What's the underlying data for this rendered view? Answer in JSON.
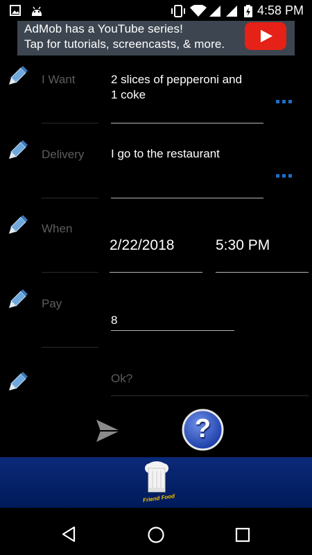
{
  "status_bar": {
    "time": "4:58 PM",
    "icons": [
      "image-icon",
      "android-icon",
      "vibrate-icon",
      "wifi-icon",
      "signal-icon",
      "signal-icon",
      "battery-charging-icon"
    ]
  },
  "ad": {
    "line1": "AdMob has a YouTube series!",
    "line2": "Tap for tutorials, screencasts, & more.",
    "icon": "youtube-play-icon",
    "brand_color": "#e62117"
  },
  "form": {
    "want": {
      "label": "I Want",
      "value_line1": "2 slices of pepperoni and",
      "value_line2": "1 coke"
    },
    "delivery": {
      "label": "Delivery",
      "value": "I go to the restaurant"
    },
    "when": {
      "label": "When",
      "date": "2/22/2018",
      "time": "5:30 PM"
    },
    "pay": {
      "label": "Pay",
      "value": "8"
    },
    "ok": {
      "placeholder": "Ok?"
    }
  },
  "actions": {
    "send_icon": "send-icon",
    "help_icon": "help-icon",
    "help_glyph": "?"
  },
  "brand": {
    "logo_text": "Friend Food",
    "icon": "chef-hat-icon"
  },
  "colors": {
    "accent": "#1d6fc7",
    "bar": "#0b2a78",
    "label": "#5d5d5d"
  },
  "nav": {
    "icons": [
      "back-icon",
      "home-icon",
      "recents-icon"
    ]
  }
}
